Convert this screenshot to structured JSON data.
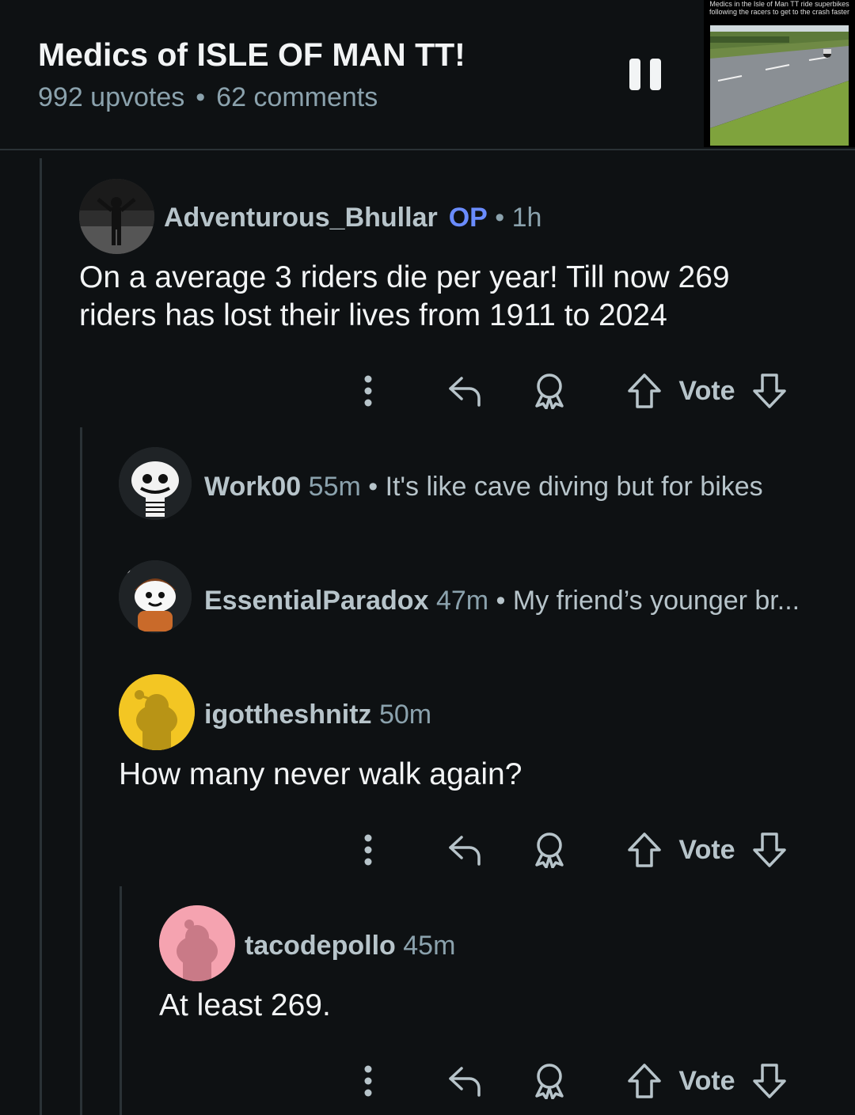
{
  "post": {
    "title": "Medics of ISLE OF MAN TT!",
    "upvotes": "992 upvotes",
    "separator": "•",
    "comments": "62 comments",
    "video_caption": "Medics in the Isle of Man TT ride superbikes following the racers to get to the crash faster"
  },
  "comments": [
    {
      "user": "Adventurous_Bhullar",
      "op_badge": "OP",
      "time": "• 1h",
      "text": "On a average 3 riders die per year! Till now 269 riders has lost their lives from 1911 to 2024",
      "vote_label": "Vote"
    },
    {
      "user": "Work00",
      "time": "55m",
      "preview": "• It's like cave diving but for bikes"
    },
    {
      "user": "EssentialParadox",
      "time": "47m",
      "preview": "• My friend’s younger br..."
    },
    {
      "user": "igottheshnitz",
      "time": "50m",
      "text": "How many never walk again?",
      "vote_label": "Vote"
    },
    {
      "user": "tacodepollo",
      "time": "45m",
      "text": "At least 269.",
      "vote_label": "Vote"
    }
  ],
  "icons": [
    "more-icon",
    "reply-icon",
    "award-icon",
    "upvote-icon",
    "downvote-icon",
    "pause-icon"
  ],
  "colors": {
    "background": "#0e1113",
    "op_badge": "#6a8cff",
    "muted": "#8ba2ad",
    "avatar_yellow": "#f3c623",
    "avatar_pink": "#f5a3b0"
  }
}
